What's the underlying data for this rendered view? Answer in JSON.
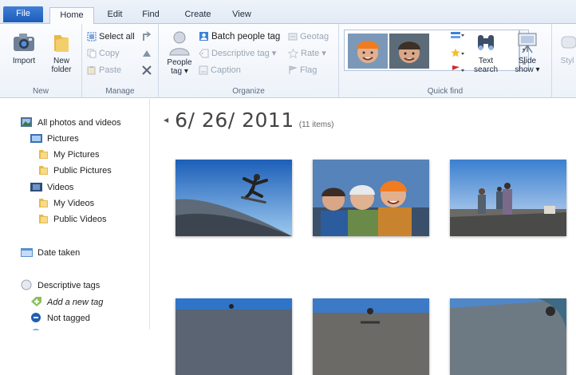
{
  "tabs": {
    "file": "File",
    "home": "Home",
    "edit": "Edit",
    "find": "Find",
    "create": "Create",
    "view": "View"
  },
  "ribbon": {
    "new": {
      "import": "Import",
      "new_folder_line1": "New",
      "new_folder_line2": "folder",
      "label": "New"
    },
    "manage": {
      "select_all": "Select all",
      "copy": "Copy",
      "paste": "Paste",
      "label": "Manage"
    },
    "organize": {
      "people_tag_line1": "People",
      "people_tag_line2": "tag ▾",
      "batch_people_tag": "Batch people tag",
      "geotag": "Geotag",
      "descriptive_tag": "Descriptive tag ▾",
      "rate": "Rate ▾",
      "caption": "Caption",
      "flag": "Flag",
      "label": "Organize"
    },
    "quickfind": {
      "text_search_line1": "Text",
      "text_search_line2": "search",
      "label": "Quick find"
    },
    "slide": {
      "line1": "Slide",
      "line2": "show ▾",
      "style_partial": "Styl"
    }
  },
  "nav": {
    "all_photos": "All photos and videos",
    "pictures": "Pictures",
    "my_pictures": "My Pictures",
    "public_pictures": "Public Pictures",
    "videos": "Videos",
    "my_videos": "My Videos",
    "public_videos": "Public Videos",
    "date_taken": "Date taken",
    "descriptive_tags": "Descriptive tags",
    "add_new_tag": "Add a new tag",
    "not_tagged": "Not tagged"
  },
  "main": {
    "date_group": "6/ 26/ 2011",
    "item_count": "(11 items)"
  },
  "colors": {
    "accent": "#1d5bb8",
    "ribbon_bg": "#edf2f9",
    "folder": "#e9b84a"
  }
}
